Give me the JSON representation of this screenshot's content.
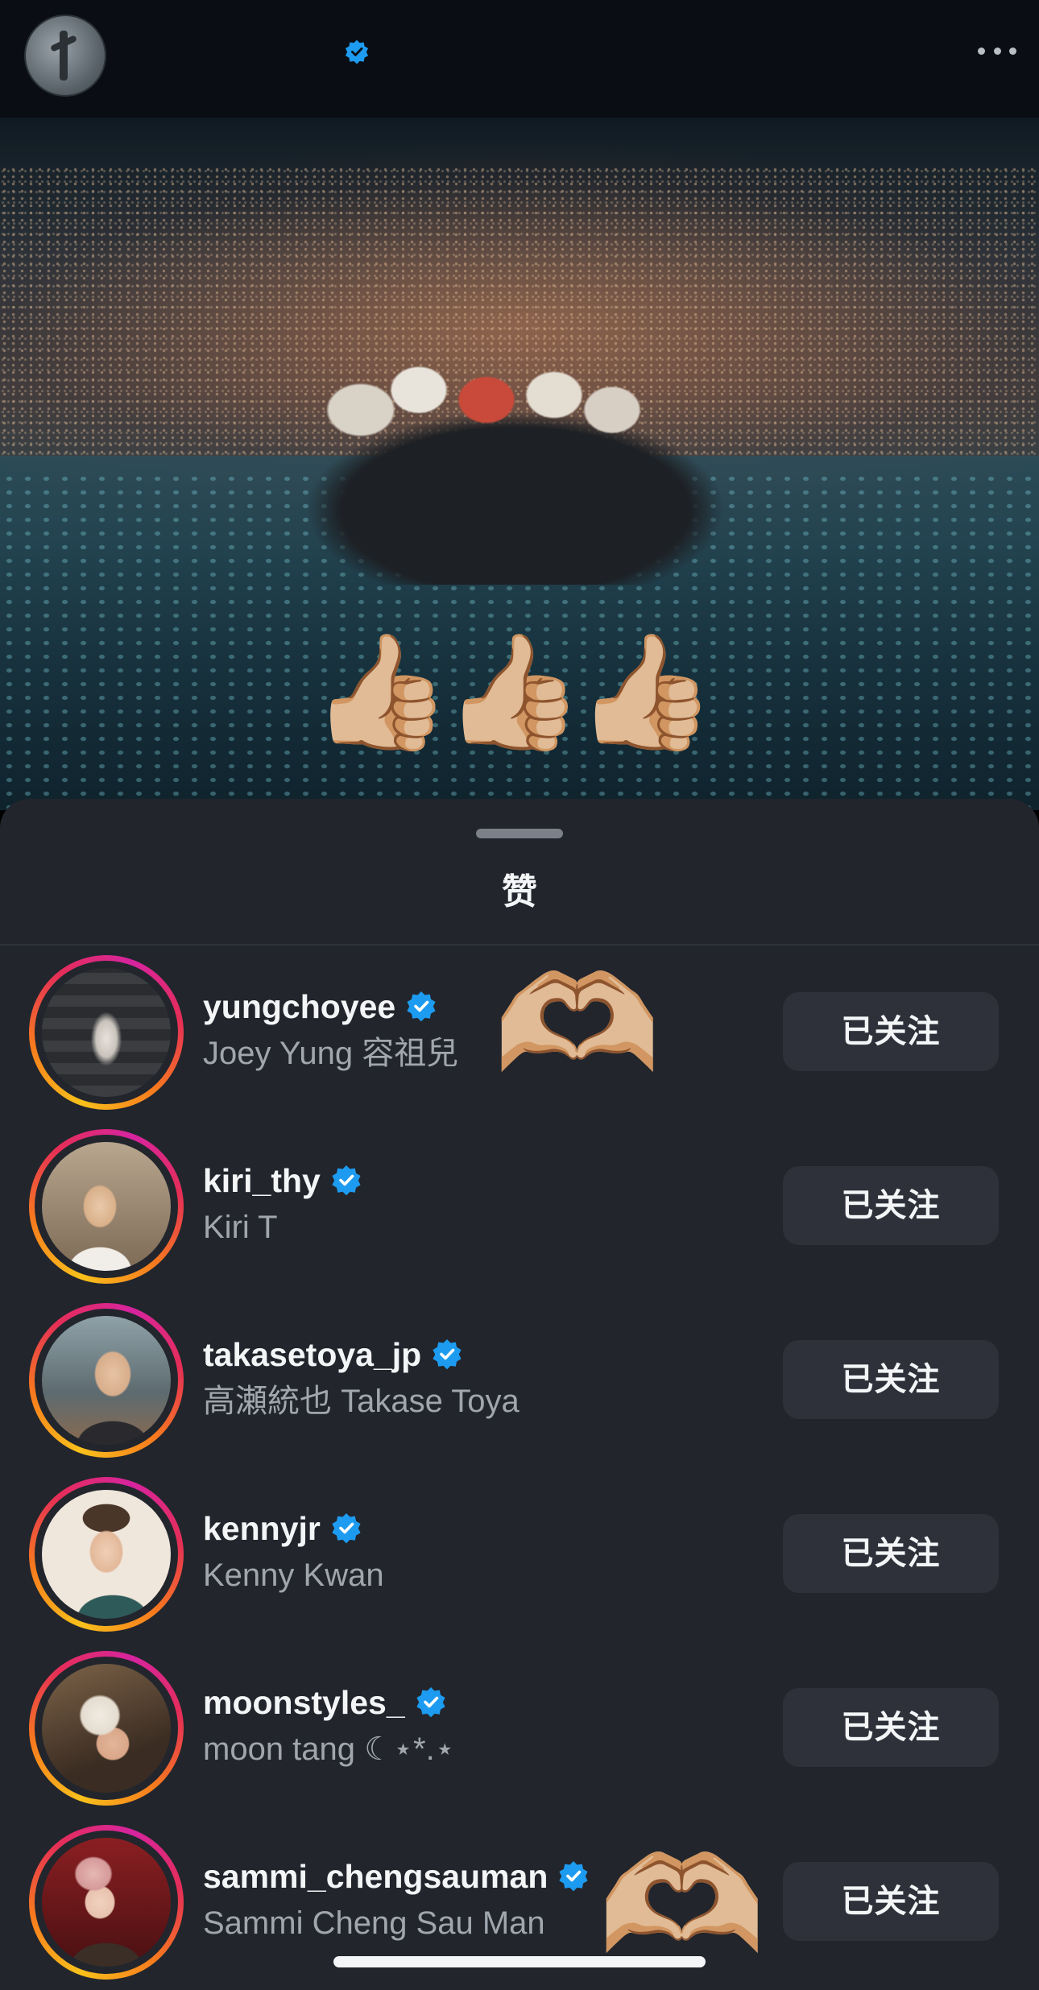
{
  "header": {
    "avatar": "concert-profile-avatar",
    "verified_icon": "verified-badge-icon",
    "more_icon": "more-options-icon"
  },
  "post": {
    "overlay_emoji": "👍🏼👍🏼👍🏼"
  },
  "likes_sheet": {
    "title": "赞",
    "users": [
      {
        "username": "yungchoyee",
        "full_name": "Joey Yung 容祖兒",
        "button": "已关注",
        "verified": true
      },
      {
        "username": "kiri_thy",
        "full_name": "Kiri T",
        "button": "已关注",
        "verified": true
      },
      {
        "username": "takasetoya_jp",
        "full_name": "高瀬統也 Takase Toya",
        "button": "已关注",
        "verified": true
      },
      {
        "username": "kennyjr",
        "full_name": "Kenny Kwan",
        "button": "已关注",
        "verified": true
      },
      {
        "username": "moonstyles_",
        "full_name": "moon tang ☾⋆*.⋆",
        "button": "已关注",
        "verified": true
      },
      {
        "username": "sammi_chengsauman",
        "full_name": "Sammi Cheng Sau Man",
        "button": "已关注",
        "verified": true
      }
    ],
    "heart_emoji": "🫶🏼"
  },
  "colors": {
    "verified_blue": "#1d9bf0",
    "sheet_bg": "#22252c",
    "button_bg": "#2e3139"
  }
}
